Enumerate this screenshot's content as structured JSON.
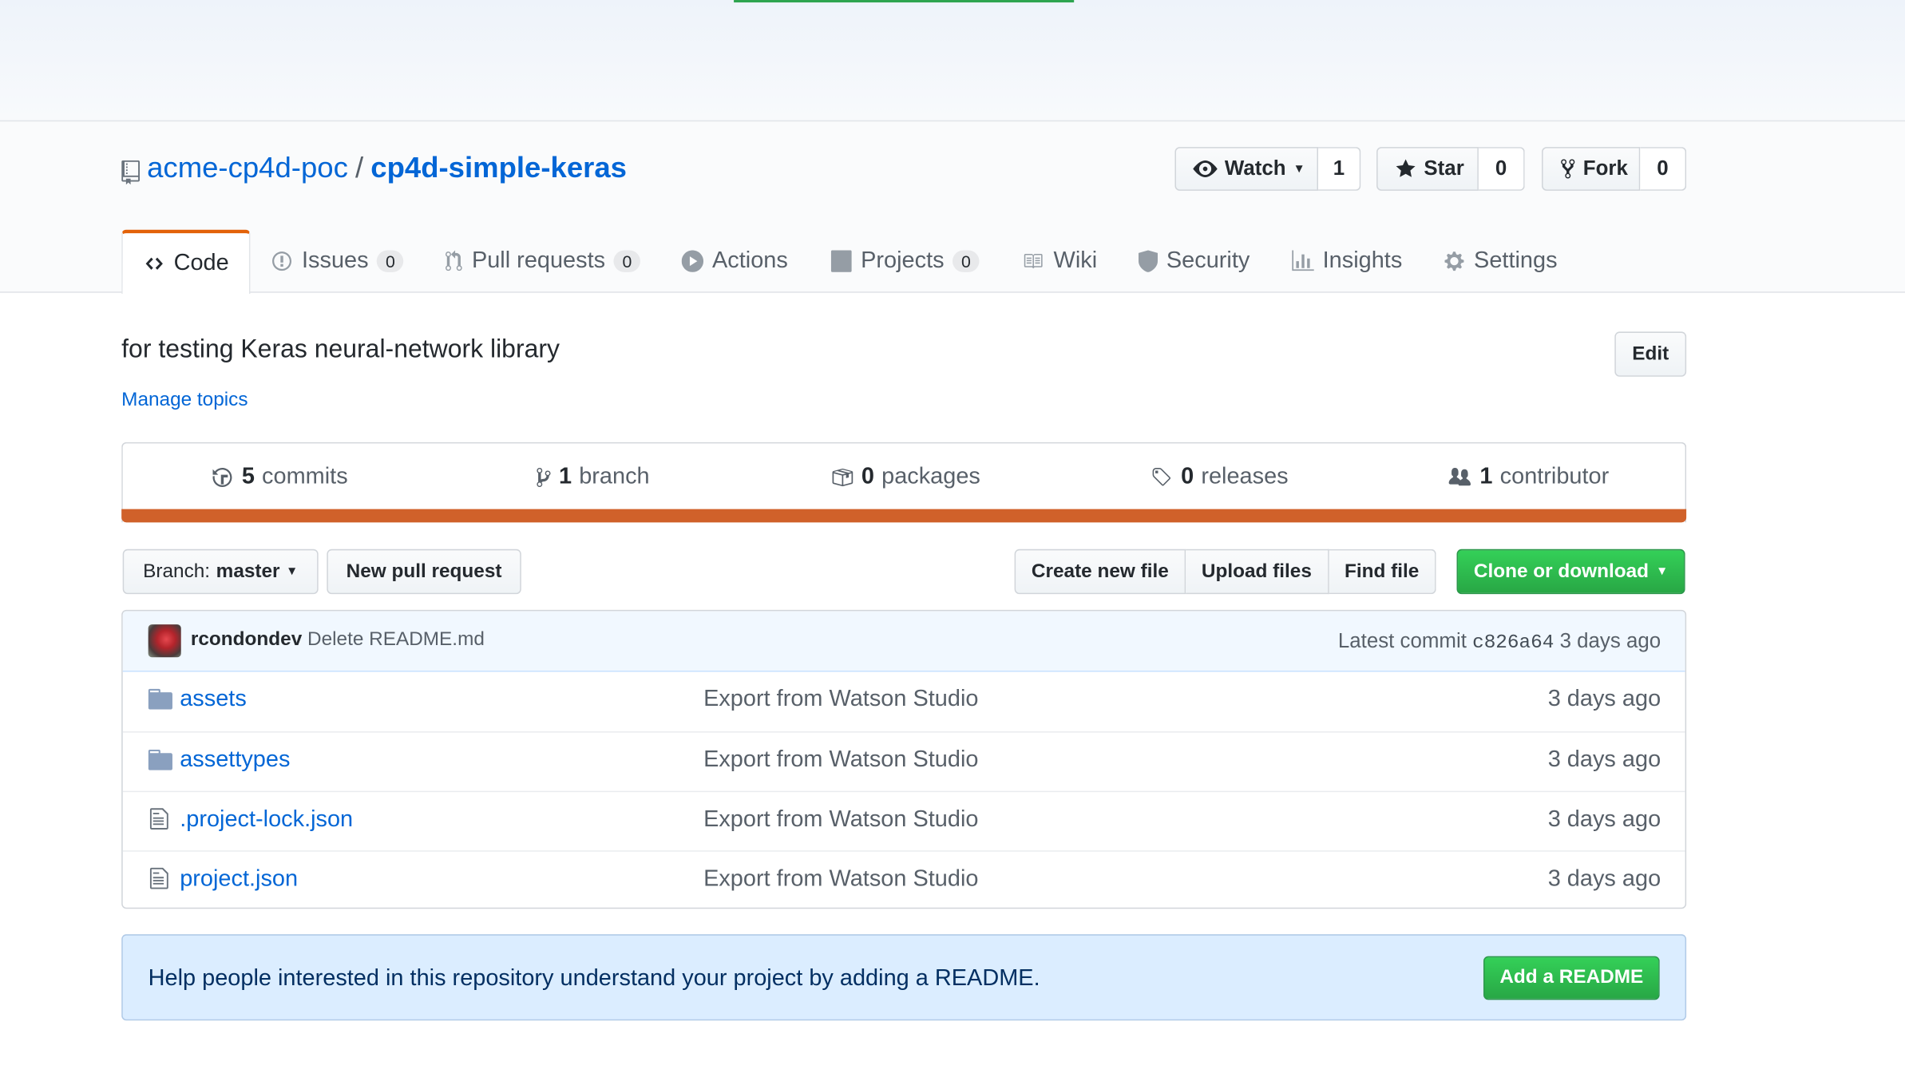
{
  "repo": {
    "owner": "acme-cp4d-poc",
    "separator": "/",
    "name": "cp4d-simple-keras"
  },
  "social": {
    "watch_label": "Watch",
    "watch_count": "1",
    "star_label": "Star",
    "star_count": "0",
    "fork_label": "Fork",
    "fork_count": "0"
  },
  "tabs": [
    {
      "label": "Code",
      "icon": "code-icon"
    },
    {
      "label": "Issues",
      "count": "0",
      "icon": "issue-icon"
    },
    {
      "label": "Pull requests",
      "count": "0",
      "icon": "pull-request-icon"
    },
    {
      "label": "Actions",
      "icon": "play-icon"
    },
    {
      "label": "Projects",
      "count": "0",
      "icon": "project-icon"
    },
    {
      "label": "Wiki",
      "icon": "book-icon"
    },
    {
      "label": "Security",
      "icon": "shield-icon"
    },
    {
      "label": "Insights",
      "icon": "graph-icon"
    },
    {
      "label": "Settings",
      "icon": "gear-icon"
    }
  ],
  "description": "for testing Keras neural-network library",
  "manage_topics": "Manage topics",
  "edit_label": "Edit",
  "summary": {
    "commits_num": "5",
    "commits_label": "commits",
    "branch_num": "1",
    "branch_label": "branch",
    "packages_num": "0",
    "packages_label": "packages",
    "releases_num": "0",
    "releases_label": "releases",
    "contributor_num": "1",
    "contributor_label": "contributor"
  },
  "language_bar_color": "#d0612a",
  "filenav": {
    "branch_prefix": "Branch:",
    "branch_name": "master",
    "new_pr": "New pull request",
    "create_file": "Create new file",
    "upload_files": "Upload files",
    "find_file": "Find file",
    "clone": "Clone or download"
  },
  "commit": {
    "author": "rcondondev",
    "message": "Delete README.md",
    "latest_label": "Latest commit",
    "sha": "c826a64",
    "age": "3 days ago"
  },
  "files": [
    {
      "name": "assets",
      "type": "dir",
      "message": "Export from Watson Studio",
      "age": "3 days ago"
    },
    {
      "name": "assettypes",
      "type": "dir",
      "message": "Export from Watson Studio",
      "age": "3 days ago"
    },
    {
      "name": ".project-lock.json",
      "type": "file",
      "message": "Export from Watson Studio",
      "age": "3 days ago"
    },
    {
      "name": "project.json",
      "type": "file",
      "message": "Export from Watson Studio",
      "age": "3 days ago"
    }
  ],
  "readme_prompt": {
    "text": "Help people interested in this repository understand your project by adding a README.",
    "button": "Add a README"
  },
  "colors": {
    "link": "#0366d6",
    "green": "#28a745",
    "tab_accent": "#e36209"
  }
}
